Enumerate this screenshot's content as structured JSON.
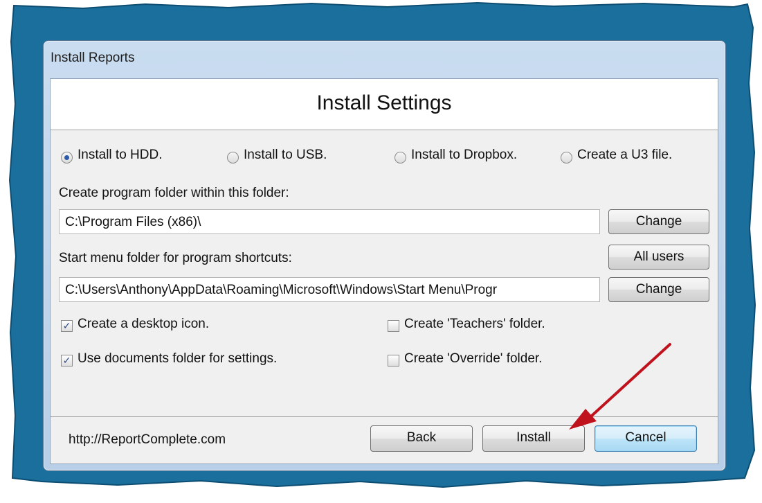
{
  "window": {
    "title": "Install Reports"
  },
  "header": {
    "title": "Install Settings"
  },
  "install_options": [
    {
      "label": "Install to HDD.",
      "selected": true
    },
    {
      "label": "Install to USB.",
      "selected": false
    },
    {
      "label": "Install to Dropbox.",
      "selected": false
    },
    {
      "label": "Create a U3 file.",
      "selected": false
    }
  ],
  "program_folder": {
    "label": "Create program folder within this folder:",
    "value": "C:\\Program Files (x86)\\",
    "change_label": "Change"
  },
  "start_menu": {
    "label": "Start menu folder for program shortcuts:",
    "value": "C:\\Users\\Anthony\\AppData\\Roaming\\Microsoft\\Windows\\Start Menu\\Progr",
    "all_users_label": "All users",
    "change_label": "Change"
  },
  "checkboxes": [
    {
      "label": "Create a desktop icon.",
      "checked": true
    },
    {
      "label": "Create 'Teachers' folder.",
      "checked": false
    },
    {
      "label": "Use documents folder for settings.",
      "checked": true
    },
    {
      "label": "Create 'Override' folder.",
      "checked": false
    }
  ],
  "footer": {
    "url": "http://ReportComplete.com",
    "back_label": "Back",
    "install_label": "Install",
    "cancel_label": "Cancel"
  },
  "colors": {
    "backdrop": "#1a6f9c",
    "arrow": "#c0121c",
    "accent": "#2a5aa8"
  },
  "icons": {
    "check": "✓"
  }
}
